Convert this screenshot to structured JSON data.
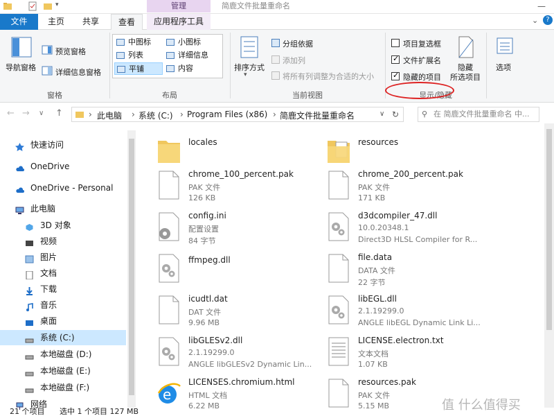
{
  "titlebar": {
    "context_tab": "管理",
    "window_title": "简鹿文件批量重命名",
    "min": "—",
    "max": "☐"
  },
  "tabs": {
    "file": "文件",
    "home": "主页",
    "share": "共享",
    "view": "查看",
    "app_tools": "应用程序工具"
  },
  "ribbon": {
    "panes": {
      "nav_pane": "导航窗格",
      "preview": "预览窗格",
      "details": "详细信息窗格",
      "label": "窗格"
    },
    "layout": {
      "medium": "中图标",
      "small": "小图标",
      "list": "列表",
      "details": "详细信息",
      "tiles": "平铺",
      "content": "内容",
      "label": "布局"
    },
    "current_view": {
      "sort": "排序方式",
      "group": "分组依据",
      "add_col": "添加列",
      "fit_cols": "将所有列调整为合适的大小",
      "label": "当前视图"
    },
    "show_hide": {
      "item_checkboxes": "项目复选框",
      "extensions": "文件扩展名",
      "hidden_items": "隐藏的项目",
      "hide": "隐藏",
      "hide_selected": "所选项目",
      "label": "显示/隐藏"
    },
    "options": "选项"
  },
  "address": {
    "crumbs": [
      "此电脑",
      "系统 (C:)",
      "Program Files (x86)",
      "简鹿文件批量重命名"
    ],
    "search_placeholder": "在 简鹿文件批量重命名 中..."
  },
  "nav": [
    "快速访问",
    "OneDrive",
    "OneDrive - Personal",
    "此电脑",
    "3D 对象",
    "视频",
    "图片",
    "文档",
    "下载",
    "音乐",
    "桌面",
    "系统 (C:)",
    "本地磁盘 (D:)",
    "本地磁盘 (E:)",
    "本地磁盘 (F:)",
    "网络"
  ],
  "files": [
    {
      "name": "locales",
      "type": "",
      "size": "",
      "icon": "folder"
    },
    {
      "name": "resources",
      "type": "",
      "size": "",
      "icon": "folder-doc"
    },
    {
      "name": "chrome_100_percent.pak",
      "type": "PAK 文件",
      "size": "126 KB",
      "icon": "blank"
    },
    {
      "name": "chrome_200_percent.pak",
      "type": "PAK 文件",
      "size": "171 KB",
      "icon": "blank"
    },
    {
      "name": "config.ini",
      "type": "配置设置",
      "size": "84 字节",
      "icon": "ini"
    },
    {
      "name": "d3dcompiler_47.dll",
      "type": "10.0.20348.1",
      "size": "Direct3D HLSL Compiler for R...",
      "icon": "dll"
    },
    {
      "name": "ffmpeg.dll",
      "type": "",
      "size": "",
      "icon": "dll"
    },
    {
      "name": "file.data",
      "type": "DATA 文件",
      "size": "22 字节",
      "icon": "blank"
    },
    {
      "name": "icudtl.dat",
      "type": "DAT 文件",
      "size": "9.96 MB",
      "icon": "blank"
    },
    {
      "name": "libEGL.dll",
      "type": "2.1.19299.0",
      "size": "ANGLE libEGL Dynamic Link Li...",
      "icon": "dll"
    },
    {
      "name": "libGLESv2.dll",
      "type": "2.1.19299.0",
      "size": "ANGLE libGLESv2 Dynamic Lin...",
      "icon": "dll"
    },
    {
      "name": "LICENSE.electron.txt",
      "type": "文本文档",
      "size": "1.07 KB",
      "icon": "txt"
    },
    {
      "name": "LICENSES.chromium.html",
      "type": "HTML 文档",
      "size": "6.22 MB",
      "icon": "html"
    },
    {
      "name": "resources.pak",
      "type": "PAK 文件",
      "size": "5.15 MB",
      "icon": "blank"
    }
  ],
  "status": {
    "count": "21 个项目",
    "selected": "选中 1 个项目 127 MB"
  },
  "watermark": "值 什么值得买",
  "colors": {
    "accent": "#1979ca",
    "selection": "#cce8ff",
    "folder": "#f0c75e",
    "highlight_oval": "#dd2222"
  }
}
